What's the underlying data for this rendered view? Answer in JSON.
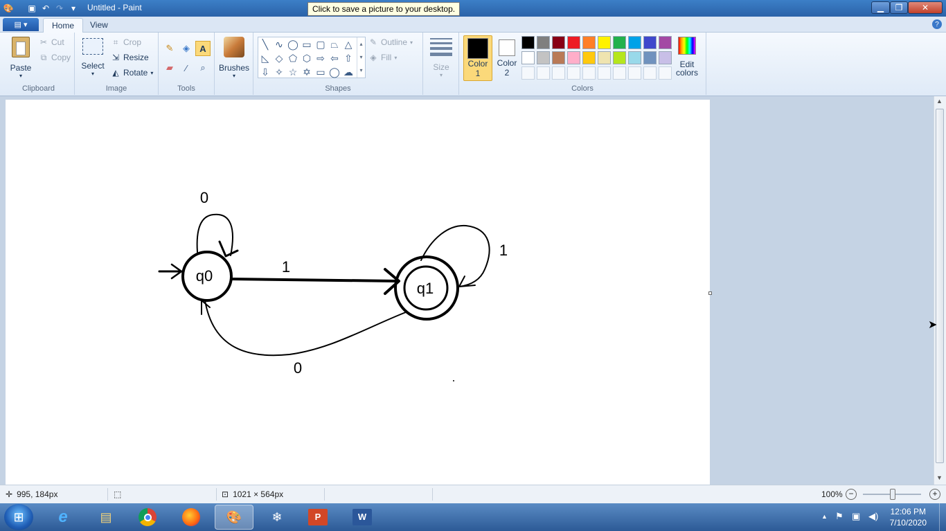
{
  "window": {
    "title": "Untitled - Paint",
    "tooltip": "Click to save a picture to your desktop."
  },
  "tabs": {
    "home": "Home",
    "view": "View"
  },
  "clipboard": {
    "paste": "Paste",
    "cut": "Cut",
    "copy": "Copy",
    "label": "Clipboard"
  },
  "image": {
    "select": "Select",
    "crop": "Crop",
    "resize": "Resize",
    "rotate": "Rotate",
    "label": "Image"
  },
  "tools": {
    "label": "Tools"
  },
  "brushes": {
    "label": "Brushes"
  },
  "shapes": {
    "outline": "Outline",
    "fill": "Fill",
    "label": "Shapes"
  },
  "size": {
    "label": "Size"
  },
  "colors": {
    "color1_line1": "Color",
    "color1_line2": "1",
    "color2_line1": "Color",
    "color2_line2": "2",
    "edit_line1": "Edit",
    "edit_line2": "colors",
    "label": "Colors",
    "row1": [
      "#000000",
      "#7f7f7f",
      "#880015",
      "#ed1c24",
      "#ff7f27",
      "#fff200",
      "#22b14c",
      "#00a2e8",
      "#3f48cc",
      "#a349a4"
    ],
    "row2": [
      "#ffffff",
      "#c3c3c3",
      "#b97a57",
      "#ffaec9",
      "#ffc90e",
      "#efe4b0",
      "#b5e61d",
      "#99d9ea",
      "#7092be",
      "#c8bfe7"
    ]
  },
  "diagram": {
    "state0": "q0",
    "state1": "q1",
    "label_loop0": "0",
    "label_transition01": "1",
    "label_loop1": "1",
    "label_transition10": "0"
  },
  "status": {
    "cursor_pos": "995, 184px",
    "canvas_size": "1021 × 564px",
    "zoom": "100%"
  },
  "clock": {
    "time": "12:06 PM",
    "date": "7/10/2020"
  }
}
